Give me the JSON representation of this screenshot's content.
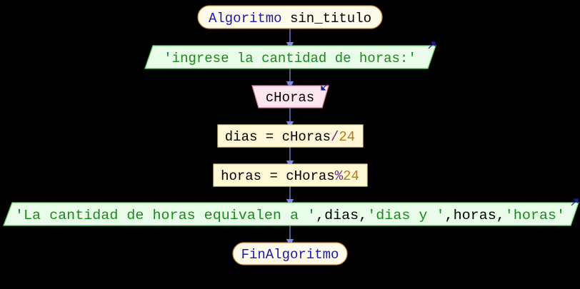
{
  "colors": {
    "background": "#000000",
    "terminal_fill": "#fffbea",
    "terminal_stroke": "#c98a3a",
    "output_fill": "#e9fbe9",
    "output_stroke": "#6ad26a",
    "input_fill": "#fde6ee",
    "input_stroke": "#d97a9a",
    "process_fill": "#fff8d6",
    "process_stroke": "#e8d99a",
    "keyword": "#1a1aa8",
    "identifier": "#000000",
    "string": "#1a8a1a",
    "number": "#b07a20",
    "operator": "#6a2a8a",
    "arrow": "#7a8ae0"
  },
  "flowchart": {
    "start": {
      "keyword": "Algoritmo",
      "name": " sin_titulo"
    },
    "output_1": {
      "string": "'ingrese la cantidad de horas:'"
    },
    "input_1": {
      "var": "cHoras"
    },
    "assign_1": {
      "lhs": "dias = cHoras",
      "op": "/",
      "num": "24"
    },
    "assign_2": {
      "lhs": "horas = cHoras",
      "op": "%",
      "num": "24"
    },
    "output_2": {
      "s1": "'La cantidad de horas equivalen a '",
      "c1": ",",
      "v1": "dias",
      "c2": ",",
      "s2": "'dias y '",
      "c3": ",",
      "v2": "horas",
      "c4": ",",
      "s3": "'horas'"
    },
    "end": {
      "keyword": "FinAlgoritmo"
    }
  }
}
